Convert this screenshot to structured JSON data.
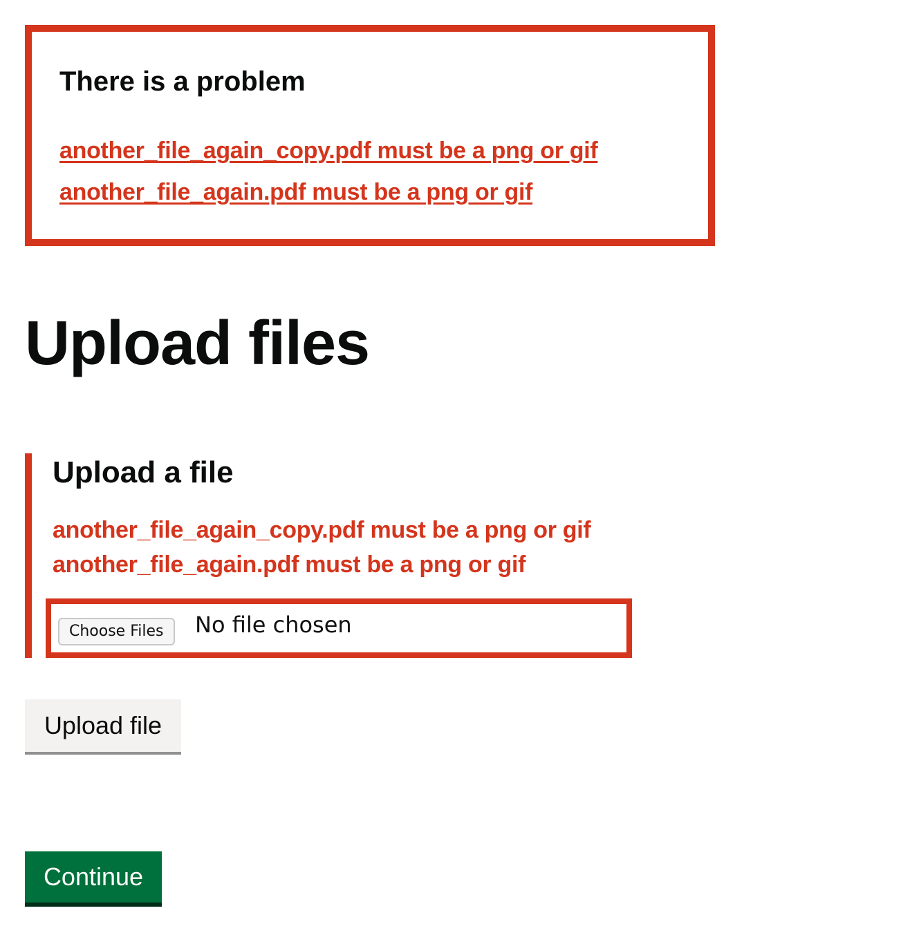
{
  "error_summary": {
    "title": "There is a problem",
    "links": [
      "another_file_again_copy.pdf must be a png or gif",
      "another_file_again.pdf must be a png or gif"
    ]
  },
  "page": {
    "title": "Upload files"
  },
  "upload_field": {
    "label": "Upload a file",
    "errors": [
      "another_file_again_copy.pdf must be a png or gif",
      "another_file_again.pdf must be a png or gif"
    ],
    "choose_button_label": "Choose Files",
    "status_text": "No file chosen"
  },
  "buttons": {
    "upload_label": "Upload file",
    "continue_label": "Continue"
  },
  "colors": {
    "error": "#d4351c",
    "primary_button": "#00703c",
    "secondary_button": "#f3f2f1",
    "text": "#0b0c0c"
  }
}
